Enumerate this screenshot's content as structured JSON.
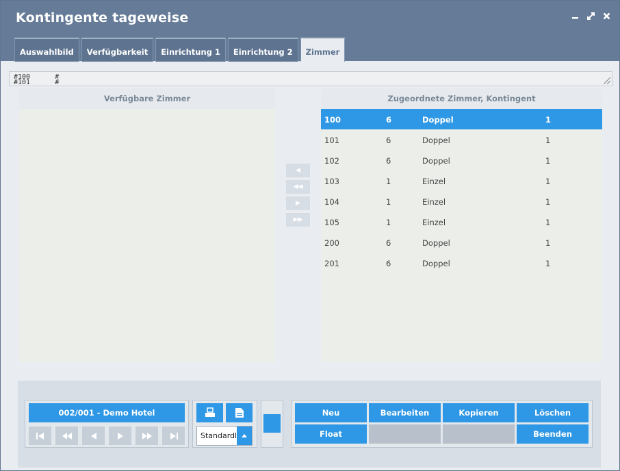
{
  "window": {
    "title": "Kontingente tageweise",
    "controls": [
      "minimize-icon",
      "maximize-icon",
      "close-icon"
    ]
  },
  "tabs": [
    {
      "label": "Auswahlbild"
    },
    {
      "label": "Verfügbarkeit"
    },
    {
      "label": "Einrichtung 1"
    },
    {
      "label": "Einrichtung 2"
    },
    {
      "label": "Zimmer",
      "active": true
    }
  ],
  "notes": {
    "line1": "#100      #",
    "line2": "#101      #"
  },
  "left_panel": {
    "header": "Verfügbare Zimmer"
  },
  "right_panel": {
    "header": "Zugeordnete Zimmer, Kontingent",
    "rows": [
      {
        "room": "100",
        "type_no": "6",
        "type": "Doppel",
        "count": "1",
        "selected": true
      },
      {
        "room": "101",
        "type_no": "6",
        "type": "Doppel",
        "count": "1"
      },
      {
        "room": "102",
        "type_no": "6",
        "type": "Doppel",
        "count": "1"
      },
      {
        "room": "103",
        "type_no": "1",
        "type": "Einzel",
        "count": "1"
      },
      {
        "room": "104",
        "type_no": "1",
        "type": "Einzel",
        "count": "1"
      },
      {
        "room": "105",
        "type_no": "1",
        "type": "Einzel",
        "count": "1"
      },
      {
        "room": "200",
        "type_no": "6",
        "type": "Doppel",
        "count": "1"
      },
      {
        "room": "201",
        "type_no": "6",
        "type": "Doppel",
        "count": "1"
      }
    ]
  },
  "transfer_buttons": [
    "◀",
    "◀◀",
    "▶",
    "▶▶"
  ],
  "footer": {
    "hotel_button": "002/001 - Demo Hotel",
    "list_select": "Standardliste",
    "actions": {
      "new": "Neu",
      "edit": "Bearbeiten",
      "copy": "Kopieren",
      "delete": "Löschen",
      "float": "Float",
      "exit": "Beenden"
    }
  },
  "colors": {
    "accent": "#2e97e6",
    "titlebar": "#657b97",
    "tab": "#5d7390"
  }
}
